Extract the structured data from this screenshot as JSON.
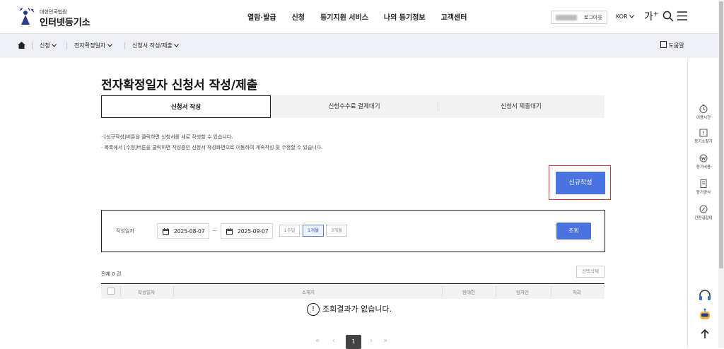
{
  "header": {
    "logo_sub": "대한민국법원",
    "logo_main": "인터넷등기소",
    "nav": [
      "열람·발급",
      "신청",
      "등기지원 서비스",
      "나의 등기정보",
      "고객센터"
    ],
    "logout_label": "로그아웃",
    "lang_label": "KOR",
    "font_size_label": "가"
  },
  "breadcrumb": {
    "items": [
      "신청",
      "전자확정일자",
      "신청서 작성/제출"
    ],
    "help_label": "도움말"
  },
  "page": {
    "title": "전자확정일자 신청서 작성/제출",
    "tabs": [
      "신청서 작성",
      "신청수수료 결제대기",
      "신청서 제출대기"
    ],
    "notices": [
      "· [신규작성]버튼을 클릭하면 신청서를 새로 작성할 수 있습니다.",
      "· 목록에서 [수정]버튼을 클릭하면 작성중인 신청서 작성화면으로 이동하여 계속작성 및 수정할 수 있습니다."
    ],
    "new_button": "신규작성"
  },
  "search": {
    "label": "작성일자",
    "date_from": "2025-08-07",
    "tilde": "~",
    "date_to": "2025-09-07",
    "periods": [
      "1주일",
      "1개월",
      "3개월"
    ],
    "active_period": "1개월",
    "query_button": "조회"
  },
  "list": {
    "total_label": "전체",
    "total_count": "0",
    "total_unit": "건",
    "delete_button": "선택삭제",
    "columns": [
      "작성일자",
      "소재지",
      "임대인",
      "임차인",
      "처리"
    ],
    "empty_message": "조회결과가 없습니다.",
    "empty_icon": "!"
  },
  "pager": {
    "first": "«",
    "prev": "‹",
    "current": "1",
    "next": "›",
    "last": "»"
  },
  "right_sidebar": {
    "items": [
      "이용시간",
      "등기소찾기",
      "등기비용",
      "등기양식",
      "간편길잡이"
    ]
  },
  "colors": {
    "primary": "#4a72e0",
    "highlight_border": "#d23434",
    "subbar_bg": "#eef0f5"
  }
}
